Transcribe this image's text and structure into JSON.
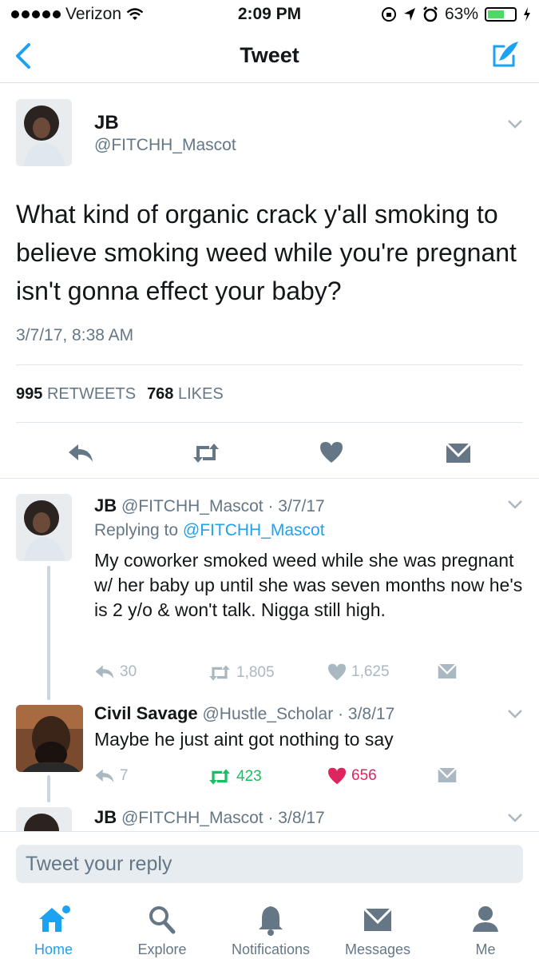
{
  "status_bar": {
    "carrier": "Verizon",
    "time": "2:09 PM",
    "battery_percent_text": "63%",
    "battery_level": 0.63
  },
  "nav": {
    "title": "Tweet"
  },
  "main_tweet": {
    "name": "JB",
    "handle": "@FITCHH_Mascot",
    "text": "What kind of organic crack y'all smoking to believe smoking weed while you're pregnant isn't gonna effect your baby?",
    "timestamp": "3/7/17, 8:38 AM",
    "retweets_count": "995",
    "retweets_label": "RETWEETS",
    "likes_count": "768",
    "likes_label": "LIKES"
  },
  "replies": [
    {
      "name": "JB",
      "handle": "@FITCHH_Mascot",
      "date": "· 3/7/17",
      "replying_prefix": "Replying to",
      "replying_to": "@FITCHH_Mascot",
      "text": "My coworker smoked weed while she was pregnant w/ her baby up until she was seven months  now he's is 2 y/o & won't talk. Nigga still high.",
      "reply_count": "30",
      "retweet_count": "1,805",
      "like_count": "1,625"
    },
    {
      "name": "Civil Savage",
      "handle": "@Hustle_Scholar",
      "date": "· 3/8/17",
      "text": "Maybe he just aint got nothing to say",
      "reply_count": "7",
      "retweet_count": "423",
      "like_count": "656"
    },
    {
      "name": "JB",
      "handle": "@FITCHH_Mascot",
      "date": "· 3/8/17"
    }
  ],
  "reply_box": {
    "placeholder": "Tweet your reply"
  },
  "tabs": [
    {
      "label": "Home",
      "icon": "home-icon"
    },
    {
      "label": "Explore",
      "icon": "search-icon"
    },
    {
      "label": "Notifications",
      "icon": "bell-icon"
    },
    {
      "label": "Messages",
      "icon": "envelope-icon"
    },
    {
      "label": "Me",
      "icon": "person-icon"
    }
  ],
  "colors": {
    "accent": "#1da1f2",
    "retweet_active": "#17bf63",
    "like_active": "#e0245e",
    "muted": "#657786"
  }
}
